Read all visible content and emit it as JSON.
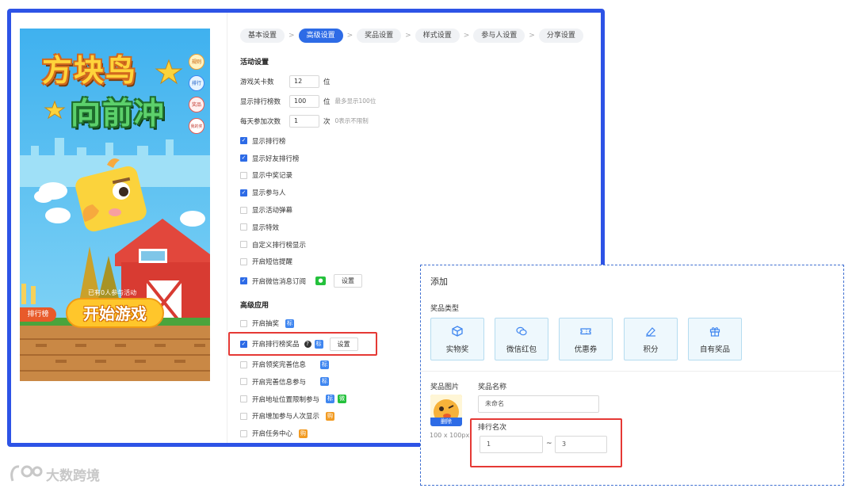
{
  "preview": {
    "title_line1": "方块鸟",
    "title_line2": "向前冲",
    "side_icons": [
      {
        "name": "rules-icon",
        "label": "规则"
      },
      {
        "name": "list-icon",
        "label": "排行"
      },
      {
        "name": "prize-icon",
        "label": "奖品"
      },
      {
        "name": "my-prize-icon",
        "label": "我的奖品"
      }
    ],
    "participants_text": "已有0人参与活动",
    "ranking_tab": "排行榜",
    "start_button": "开始游戏"
  },
  "steps": [
    {
      "label": "基本设置",
      "active": false
    },
    {
      "label": "高级设置",
      "active": true
    },
    {
      "label": "奖品设置",
      "active": false
    },
    {
      "label": "样式设置",
      "active": false
    },
    {
      "label": "参与人设置",
      "active": false
    },
    {
      "label": "分享设置",
      "active": false
    }
  ],
  "activity": {
    "section_title": "活动设置",
    "levels": {
      "label": "游戏关卡数",
      "value": "12",
      "unit": "位"
    },
    "rank_count": {
      "label": "显示排行榜数",
      "value": "100",
      "unit": "位",
      "hint": "最多显示100位"
    },
    "daily": {
      "label": "每天参加次数",
      "value": "1",
      "unit": "次",
      "hint": "0表示不限制"
    },
    "checks": [
      {
        "label": "显示排行榜",
        "checked": true
      },
      {
        "label": "显示好友排行榜",
        "checked": true
      },
      {
        "label": "显示中奖记录",
        "checked": false
      },
      {
        "label": "显示参与人",
        "checked": true
      },
      {
        "label": "显示活动弹幕",
        "checked": false
      },
      {
        "label": "显示特效",
        "checked": false
      },
      {
        "label": "自定义排行榜显示",
        "checked": false
      },
      {
        "label": "开启短信提醒",
        "checked": false
      }
    ],
    "wechat_sub": {
      "label": "开启微信消息订阅",
      "button": "设置"
    }
  },
  "advanced": {
    "section_title": "高级应用",
    "lottery": {
      "label": "开启抽奖",
      "badge": "标"
    },
    "rank_prize": {
      "label": "开启排行榜奖品",
      "help": "?",
      "badge": "标",
      "button": "设置"
    },
    "items": [
      {
        "label": "开启领奖完善信息",
        "badge": "标",
        "badge_color": "blue"
      },
      {
        "label": "开启完善信息参与",
        "badge": "标",
        "badge_color": "blue"
      },
      {
        "label": "开启地址位置限制参与",
        "badge": "标",
        "badge_color": "blue",
        "badge2": "微"
      },
      {
        "label": "开启增加参与人次显示",
        "badge": "购",
        "badge_color": "orange"
      },
      {
        "label": "开启任务中心",
        "badge": "购",
        "badge_color": "orange"
      }
    ]
  },
  "dialog": {
    "title": "添加",
    "prize_type_label": "奖品类型",
    "types": [
      {
        "label": "实物奖",
        "icon": "box-icon"
      },
      {
        "label": "微信红包",
        "icon": "wechat-icon"
      },
      {
        "label": "优惠券",
        "icon": "coupon-icon"
      },
      {
        "label": "积分",
        "icon": "points-icon"
      },
      {
        "label": "自有奖品",
        "icon": "gift-icon"
      }
    ],
    "image_label": "奖品图片",
    "delete_label": "删除",
    "image_size": "100 x 100px",
    "name_label": "奖品名称",
    "name_value": "未命名",
    "rank_label": "排行名次",
    "rank_from": "1",
    "rank_sep": "~",
    "rank_to": "3"
  },
  "watermark": "大数跨境",
  "colors": {
    "primary": "#2d6be6",
    "frame": "#2d53e6",
    "highlight": "#e53935"
  }
}
